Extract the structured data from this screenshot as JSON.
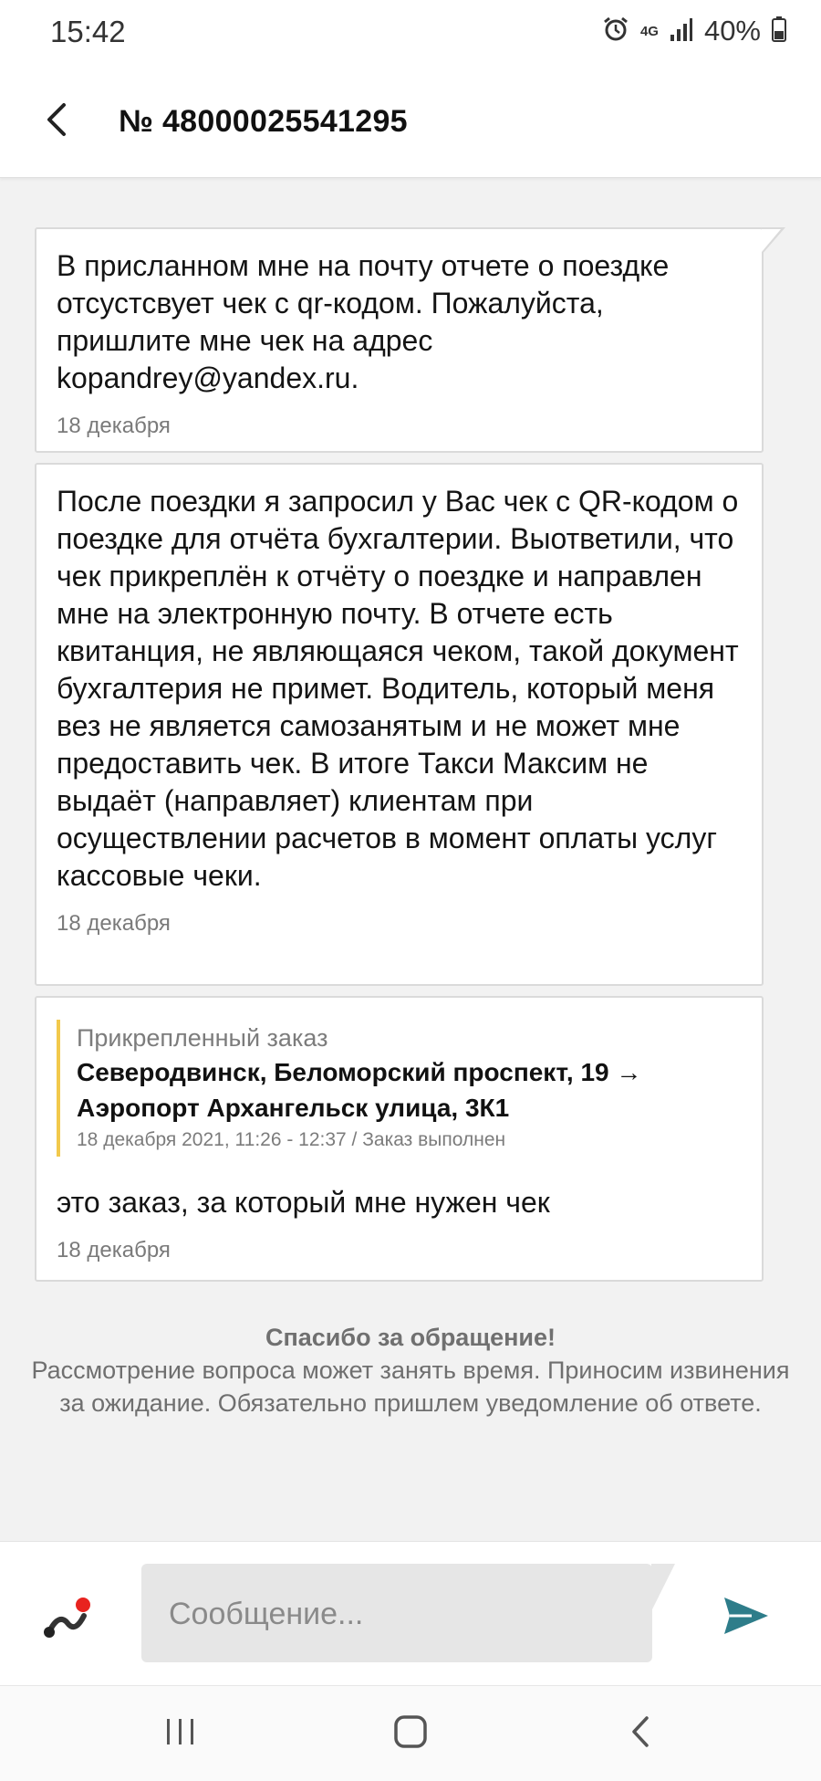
{
  "status_bar": {
    "time": "15:42",
    "network": "4G",
    "battery": "40%"
  },
  "header": {
    "title": "№ 48000025541295"
  },
  "messages": [
    {
      "text": "В присланном мне на почту отчете о поездке отсустсвует чек с qr-кодом. Пожалуйста, пришлите мне чек на адрес kopandrey@yandex.ru.",
      "date": "18 декабря"
    },
    {
      "text": "После поездки я запросил у Вас чек с QR-кодом о поездке для отчёта бухгалтерии. Выответили, что чек прикреплён к отчёту о поездке и направлен мне на электронную почту. В отчете есть квитанция, не являющаяся чеком, такой документ бухгалтерия не примет. Водитель, который меня вез не является самозанятым и не может мне предоставить чек. В итоге Такси Максим не выдаёт (направляет) клиентам при осуществлении расчетов в момент оплаты услуг кассовые чеки.",
      "date": "18 декабря"
    },
    {
      "attached_order": {
        "caption": "Прикрепленный заказ",
        "route": "Северодвинск, Беломорский проспект, 19 → Аэропорт Архангельск улица, 3К1",
        "meta": "18 декабря 2021, 11:26 - 12:37 / Заказ выполнен"
      },
      "text": "это заказ, за который мне нужен чек",
      "date": "18 декабря"
    }
  ],
  "info": {
    "heading": "Спасибо за обращение!",
    "body": "Рассмотрение вопроса может занять время. Приносим извинения за ожидание. Обязательно пришлем уведомление об ответе."
  },
  "composer": {
    "placeholder": "Сообщение...",
    "value": ""
  },
  "colors": {
    "send_icon": "#2e7d8a",
    "attach_dot": "#e8231f",
    "order_accent": "#f2c94c"
  },
  "icons": {
    "back": "back-arrow-icon",
    "attach": "attach-icon",
    "send": "send-icon",
    "alarm": "alarm-icon",
    "signal": "signal-icon",
    "battery": "battery-icon"
  }
}
